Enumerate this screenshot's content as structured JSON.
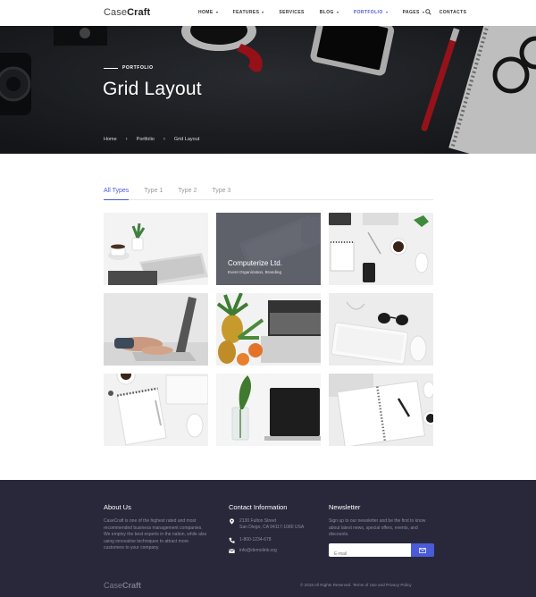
{
  "header": {
    "logo_light": "Case",
    "logo_bold": "Craft",
    "nav": [
      {
        "label": "HOME",
        "caret": true
      },
      {
        "label": "FEATURES",
        "caret": true
      },
      {
        "label": "SERVICES",
        "caret": false
      },
      {
        "label": "BLOG",
        "caret": true
      },
      {
        "label": "PORTFOLIO",
        "caret": true,
        "active": true
      },
      {
        "label": "PAGES",
        "caret": true
      },
      {
        "label": "CONTACTS",
        "caret": false
      }
    ],
    "search_icon": "search-icon"
  },
  "hero": {
    "label": "PORTFOLIO",
    "title": "Grid Layout",
    "breadcrumbs": [
      "Home",
      "Portfolio",
      "Grid Layout"
    ]
  },
  "filters": [
    "All Types",
    "Type 1",
    "Type 2",
    "Type 3"
  ],
  "grid": {
    "featured": {
      "title": "Computerize Ltd.",
      "subtitle": "Event Organization, Branding"
    }
  },
  "footer": {
    "about": {
      "heading": "About Us",
      "text": "CaseCraft is one of the highest rated and most recommended business management companies. We employ the best experts in the nation, while also using innovative techniques to attract more customers to your company."
    },
    "contact": {
      "heading": "Contact Information",
      "address_line1": "2130 Fulton Street",
      "address_line2": "San Diego, CA 94117-1080 USA",
      "phone": "1-800-1234-678",
      "email": "info@demolink.org"
    },
    "newsletter": {
      "heading": "Newsletter",
      "text": "Sign up to our newsletter and be the first to know about latest news, special offers, events, and discounts.",
      "placeholder": "E-mail"
    },
    "logo_light": "Case",
    "logo_bold": "Craft",
    "copyright": "© 2018 All Rights Reserved. Terms of Use and Privacy Policy"
  },
  "colors": {
    "accent": "#4a5bd8",
    "footer_bg": "#28283a",
    "hero_bg": "#1f2126"
  }
}
